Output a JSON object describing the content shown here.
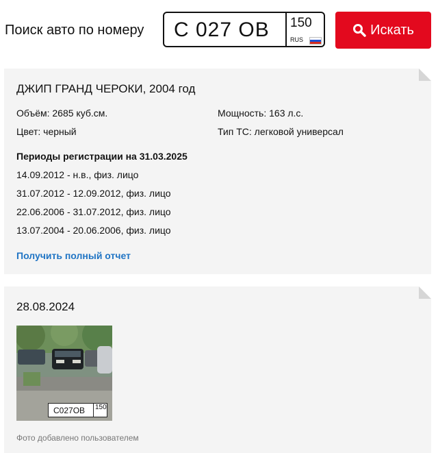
{
  "search": {
    "title": "Поиск авто по номеру",
    "plate_number": "С 027 ОВ",
    "plate_region": "150",
    "plate_country": "RUS",
    "button_label": "Искать",
    "button_color": "#e3091e"
  },
  "vehicle": {
    "title": "ДЖИП ГРАНД ЧЕРОКИ, 2004 год",
    "volume": "Объём: 2685 куб.см.",
    "power": "Мощность: 163 л.с.",
    "color": "Цвет: черный",
    "type": "Тип ТС: легковой универсал",
    "periods_heading": "Периоды регистрации на 31.03.2025",
    "periods": [
      "14.09.2012 - н.в., физ. лицо",
      "31.07.2012 - 12.09.2012, физ. лицо",
      "22.06.2006 - 31.07.2012, физ. лицо",
      "13.07.2004 - 20.06.2006, физ. лицо"
    ],
    "report_link": "Получить полный отчет",
    "link_color": "#1f74c4"
  },
  "photo_card": {
    "date": "28.08.2024",
    "plate_number": "С027ОВ",
    "plate_region": "150",
    "caption": "Фото добавлено пользователем"
  }
}
